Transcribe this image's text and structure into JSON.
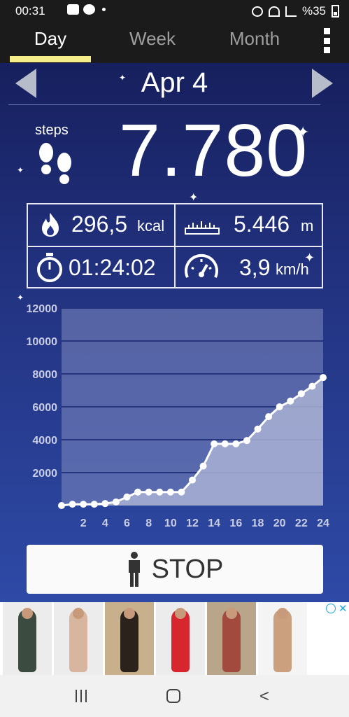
{
  "status_bar": {
    "time": "00:31",
    "battery": "%35"
  },
  "tabs": [
    {
      "label": "Day",
      "active": true
    },
    {
      "label": "Week",
      "active": false
    },
    {
      "label": "Month",
      "active": false
    }
  ],
  "header": {
    "date": "Apr 4"
  },
  "steps": {
    "label": "steps",
    "value": "7.780"
  },
  "stats": {
    "calories": {
      "value": "296,5",
      "unit": "kcal"
    },
    "distance": {
      "value": "5.446",
      "unit": "m"
    },
    "duration": {
      "value": "01:24:02"
    },
    "speed": {
      "value": "3,9",
      "unit": "km/h"
    }
  },
  "chart_data": {
    "type": "area",
    "x": [
      0,
      1,
      2,
      3,
      4,
      5,
      6,
      7,
      8,
      9,
      10,
      11,
      12,
      13,
      14,
      15,
      16,
      17,
      18,
      19,
      20,
      21,
      22,
      23,
      24
    ],
    "values": [
      0,
      80,
      80,
      80,
      120,
      220,
      520,
      820,
      820,
      820,
      820,
      820,
      1550,
      2400,
      3750,
      3750,
      3750,
      3950,
      4650,
      5400,
      6000,
      6350,
      6800,
      7250,
      7780
    ],
    "xticks": [
      "2",
      "4",
      "6",
      "8",
      "10",
      "12",
      "14",
      "16",
      "18",
      "20",
      "22",
      "24"
    ],
    "yticks": [
      "2000",
      "4000",
      "6000",
      "8000",
      "10000",
      "12000"
    ],
    "xlim": [
      0,
      24
    ],
    "ylim": [
      0,
      12000
    ],
    "grid": true
  },
  "stop_button": {
    "label": "STOP"
  },
  "colors": {
    "background_top": "#17205e",
    "background_bottom": "#2e4aa6",
    "tab_underline": "#f5ec8a",
    "chart_fill": "#a9b2d3",
    "chart_line": "#ffffff"
  }
}
